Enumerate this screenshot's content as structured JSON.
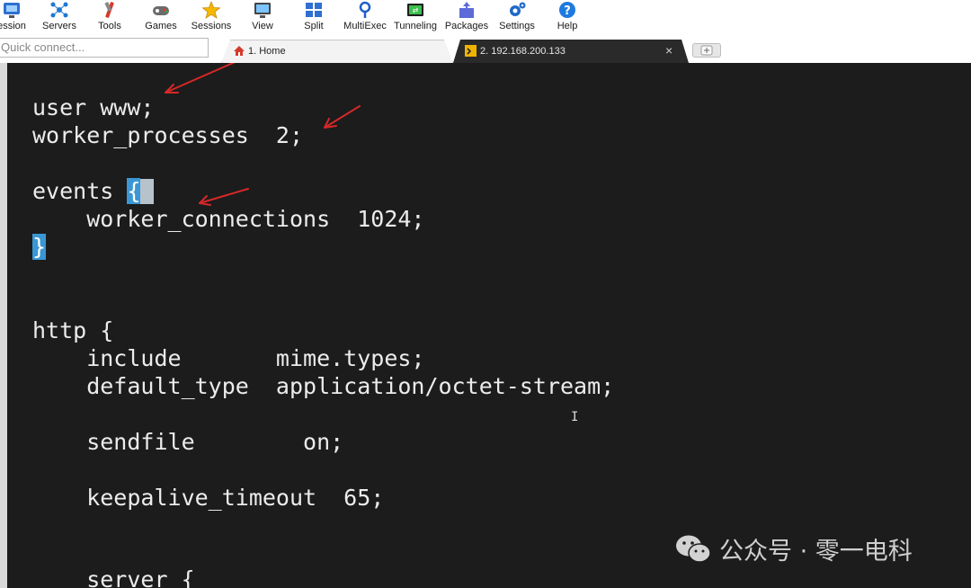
{
  "toolbar": {
    "items": [
      {
        "label": "ession",
        "icon": "session-icon"
      },
      {
        "label": "Servers",
        "icon": "servers-icon"
      },
      {
        "label": "Tools",
        "icon": "tools-icon"
      },
      {
        "label": "Games",
        "icon": "games-icon"
      },
      {
        "label": "Sessions",
        "icon": "star-icon"
      },
      {
        "label": "View",
        "icon": "view-icon"
      },
      {
        "label": "Split",
        "icon": "split-icon"
      },
      {
        "label": "MultiExec",
        "icon": "multiexec-icon"
      },
      {
        "label": "Tunneling",
        "icon": "tunneling-icon"
      },
      {
        "label": "Packages",
        "icon": "packages-icon"
      },
      {
        "label": "Settings",
        "icon": "gear-icon"
      },
      {
        "label": "Help",
        "icon": "help-icon"
      }
    ]
  },
  "quick_connect": {
    "placeholder": "Quick connect..."
  },
  "tabs": [
    {
      "label": "1. Home",
      "icon": "home-icon",
      "active": false
    },
    {
      "label": "2. 192.168.200.133",
      "icon": "terminal-icon",
      "active": true,
      "close": "×"
    }
  ],
  "terminal": {
    "lines": [
      "user www;",
      "worker_processes  2;",
      "",
      "events ",
      "    worker_connections  1024;",
      "}",
      "",
      "",
      "http {",
      "    include       mime.types;",
      "    default_type  application/octet-stream;",
      "",
      "    sendfile        on;",
      "",
      "    keepalive_timeout  65;",
      "",
      "",
      "    server {"
    ],
    "events_brace": "{",
    "closing_brace": "}",
    "cursor_glyph": "I"
  },
  "watermark": {
    "text": "公众号 · 零一电科",
    "icon": "wechat-icon"
  },
  "colors": {
    "terminal_bg": "#1c1c1c",
    "terminal_fg": "#ececec",
    "highlight": "#3a97d4",
    "annotation_arrow": "#d62828"
  }
}
